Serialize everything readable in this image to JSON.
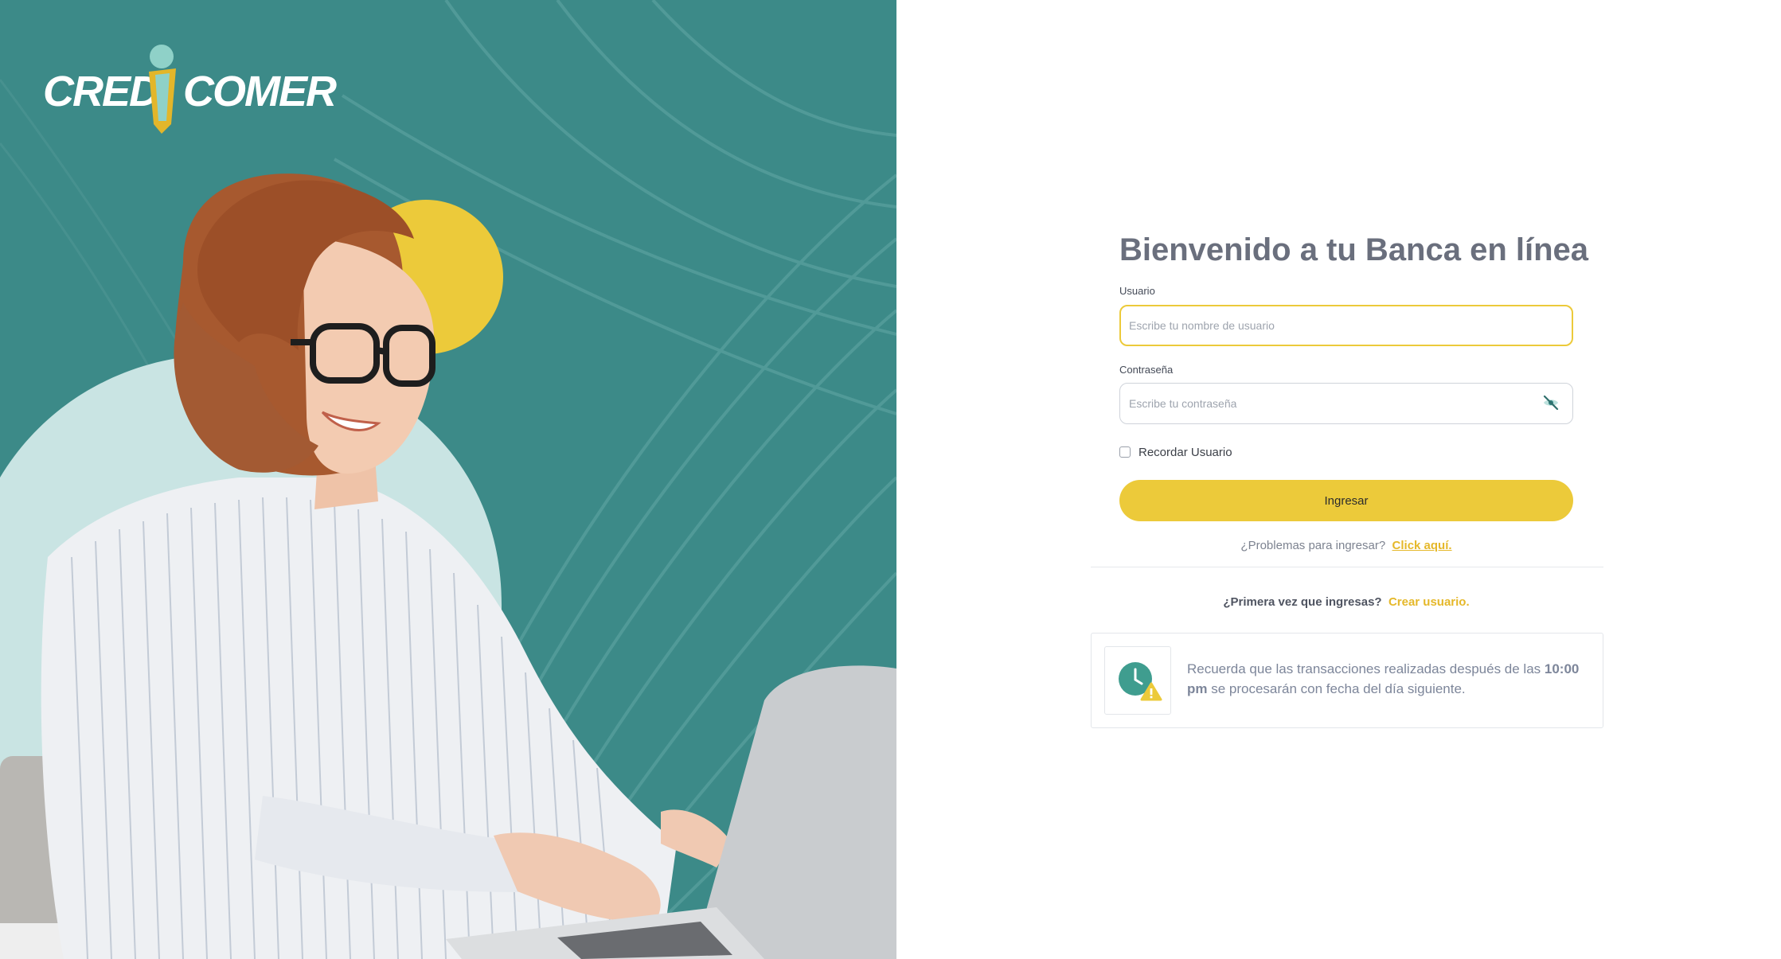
{
  "brand": {
    "logo_left": "CRED",
    "logo_right": "COMER",
    "logo_name": "CREDICOMER"
  },
  "login": {
    "title": "Bienvenido a tu Banca en línea",
    "username_label": "Usuario",
    "username_placeholder": "Escribe tu nombre de usuario",
    "username_value": "",
    "password_label": "Contraseña",
    "password_placeholder": "Escribe tu contraseña",
    "password_value": "",
    "remember_label": "Recordar Usuario",
    "remember_checked": false,
    "submit_label": "Ingresar"
  },
  "help": {
    "question": "¿Problemas para ingresar?",
    "link": "Click aquí."
  },
  "first_time": {
    "question": "¿Primera vez que ingresas?",
    "link": "Crear usuario."
  },
  "notice": {
    "text_before": "Recuerda que las transacciones realizadas después de las ",
    "time": "10:00 pm",
    "text_after": " se procesarán con fecha del día siguiente.",
    "icon": "clock-warning-icon"
  },
  "colors": {
    "accent_yellow": "#ecca3a",
    "teal": "#3c8a88",
    "light_teal": "#c9e4e3",
    "title_gray": "#6a6f7d"
  }
}
